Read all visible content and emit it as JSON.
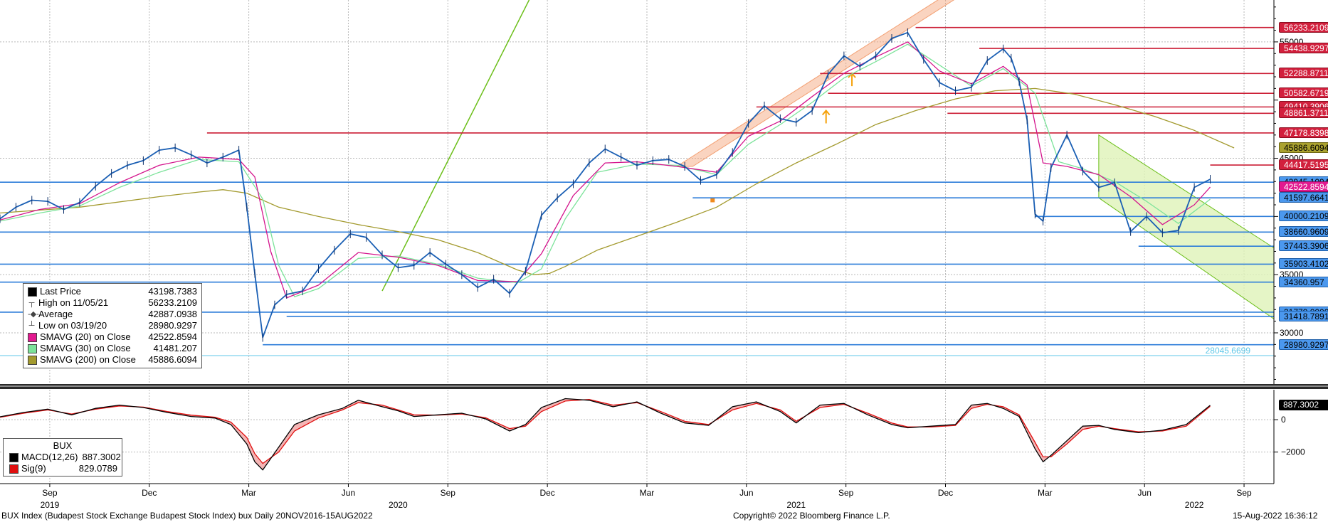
{
  "footer": {
    "left": "BUX Index (Budapest Stock Exchange Budapest Stock Index) bux  Daily 20NOV2016-15AUG2022",
    "center": "Copyright© 2022 Bloomberg Finance L.P.",
    "right": "15-Aug-2022 16:36:12"
  },
  "colors": {
    "price": "#1a5fb4",
    "sma20": "#d4148c",
    "sma30": "#7ce39a",
    "sma200": "#a39a2e",
    "resistance": "#cc1f36",
    "support": "#2e7ed9",
    "trend": "#6cbf1a",
    "channel": "#f3a073",
    "macd": "#000000",
    "signal": "#e01010",
    "hist_fill": "#f2a3a3"
  },
  "upper_legend": {
    "rows": [
      {
        "glyph": "■",
        "label": "Last Price",
        "value": "43198.7383",
        "color": "#000000"
      },
      {
        "glyph": "┬",
        "label": "High on 11/05/21",
        "value": "56233.2109"
      },
      {
        "glyph": "-◆-",
        "label": "Average",
        "value": "42887.0938"
      },
      {
        "glyph": "┴",
        "label": "Low on 03/19/20",
        "value": "28980.9297"
      },
      {
        "glyph": "■",
        "label": "SMAVG (20)  on Close",
        "value": "42522.8594",
        "color": "#e2198f"
      },
      {
        "glyph": "■",
        "label": "SMAVG (30)  on Close",
        "value": "41481.207",
        "color": "#7ce39a"
      },
      {
        "glyph": "■",
        "label": "SMAVG (200)  on Close",
        "value": "45886.6094",
        "color": "#a39a2e"
      }
    ]
  },
  "lower_legend": {
    "title": "BUX",
    "rows": [
      {
        "label": "MACD(12,26)",
        "value": "887.3002",
        "color": "#000000"
      },
      {
        "label": "Sig(9)",
        "value": "829.0789",
        "color": "#e01010"
      }
    ]
  },
  "right_tags": [
    {
      "text": "56233.2109",
      "kind": "resistance",
      "price": 56233.2109
    },
    {
      "text": "54438.9297",
      "kind": "resistance",
      "price": 54438.9297
    },
    {
      "text": "52288.8711",
      "kind": "resistance",
      "price": 52288.8711
    },
    {
      "text": "50582.6719",
      "kind": "resistance",
      "price": 50582.6719
    },
    {
      "text": "49410.3906",
      "kind": "resistance",
      "price": 49410.3906
    },
    {
      "text": "48861.3711",
      "kind": "resistance",
      "price": 48861.3711
    },
    {
      "text": "47178.8398",
      "kind": "resistance",
      "price": 47178.8398
    },
    {
      "text": "45886.6094",
      "kind": "sma200",
      "price": 45886.6094
    },
    {
      "text": "44417.5195",
      "kind": "resistance",
      "price": 44417.5195
    },
    {
      "text": "42945.1094",
      "kind": "support",
      "price": 42945.1094
    },
    {
      "text": "42522.8594",
      "kind": "sma20",
      "price": 42522.8594
    },
    {
      "text": "41597.6641",
      "kind": "support",
      "price": 41597.6641
    },
    {
      "text": "40000.2109",
      "kind": "support",
      "price": 40000.2109
    },
    {
      "text": "38660.9609",
      "kind": "support",
      "price": 38660.9609
    },
    {
      "text": "37443.3906",
      "kind": "support",
      "price": 37443.3906
    },
    {
      "text": "35903.4102",
      "kind": "support",
      "price": 35903.4102
    },
    {
      "text": "34360.957",
      "kind": "support",
      "price": 34360.957
    },
    {
      "text": "31779.0000",
      "kind": "support",
      "price": 31779.0
    },
    {
      "text": "31418.7891",
      "kind": "support",
      "price": 31418.7891
    },
    {
      "text": "28980.9297",
      "kind": "support",
      "price": 28980.9297
    }
  ],
  "low_label": "28045.6699",
  "macd_tag": "887.3002",
  "chart_data": [
    {
      "type": "line",
      "title": "",
      "subtitle": "",
      "xlabel": "",
      "ylabel": "",
      "y_tick_labels": [
        "55000",
        "45000",
        "35000",
        "30000"
      ],
      "y_ticks": [
        55000,
        45000,
        35000,
        30000
      ],
      "ylim": [
        25600,
        58600
      ],
      "x_tick_labels": [
        "Sep",
        "Dec",
        "Mar",
        "Jun",
        "Sep",
        "Dec",
        "Mar",
        "Jun",
        "Sep",
        "Dec",
        "Mar",
        "Jun",
        "Sep"
      ],
      "x_tick_positions": [
        0.125,
        0.375,
        0.625,
        0.875,
        1.125,
        1.375,
        1.625,
        1.875,
        2.125,
        2.375,
        2.625,
        2.875,
        3.125
      ],
      "year_labels": [
        {
          "text": "2019",
          "pos": 0.125
        },
        {
          "text": "2020",
          "pos": 1.0
        },
        {
          "text": "2021",
          "pos": 2.0
        },
        {
          "text": "2022",
          "pos": 3.0
        }
      ],
      "x_domain": [
        0.0,
        3.2
      ],
      "grid": true,
      "legend": "bottom-left",
      "series": [
        {
          "name": "Last Price",
          "x": [
            0.0,
            0.04,
            0.08,
            0.12,
            0.16,
            0.2,
            0.24,
            0.28,
            0.32,
            0.36,
            0.4,
            0.44,
            0.48,
            0.52,
            0.56,
            0.6,
            0.62,
            0.64,
            0.66,
            0.69,
            0.72,
            0.76,
            0.8,
            0.84,
            0.88,
            0.92,
            0.96,
            1.0,
            1.04,
            1.08,
            1.12,
            1.16,
            1.2,
            1.24,
            1.28,
            1.32,
            1.36,
            1.4,
            1.44,
            1.48,
            1.52,
            1.56,
            1.6,
            1.64,
            1.68,
            1.72,
            1.76,
            1.8,
            1.84,
            1.88,
            1.92,
            1.96,
            2.0,
            2.04,
            2.08,
            2.12,
            2.16,
            2.2,
            2.24,
            2.28,
            2.32,
            2.36,
            2.4,
            2.44,
            2.48,
            2.52,
            2.54,
            2.56,
            2.58,
            2.6,
            2.62,
            2.64,
            2.68,
            2.72,
            2.76,
            2.8,
            2.84,
            2.88,
            2.92,
            2.96,
            3.0,
            3.04
          ],
          "y": [
            39800,
            40800,
            41400,
            41300,
            40600,
            41200,
            42600,
            43700,
            44400,
            44800,
            45700,
            45900,
            45300,
            44600,
            45100,
            45700,
            40800,
            35100,
            29600,
            32400,
            33300,
            33600,
            35500,
            37100,
            38500,
            38200,
            36700,
            35600,
            35800,
            36900,
            35900,
            35000,
            33900,
            34600,
            33400,
            35300,
            40100,
            41600,
            42800,
            44600,
            45800,
            45100,
            44400,
            44800,
            44900,
            44300,
            43100,
            43600,
            45500,
            48000,
            49500,
            48400,
            48100,
            49100,
            52200,
            53800,
            52900,
            53800,
            55300,
            55800,
            53500,
            51500,
            50800,
            51100,
            53400,
            54400,
            53600,
            51600,
            48300,
            40200,
            39600,
            44200,
            47000,
            43900,
            42500,
            42900,
            38700,
            40000,
            38600,
            38800,
            42500,
            43200
          ]
        },
        {
          "name": "SMAVG (20) on Close",
          "x": [
            0.0,
            0.1,
            0.2,
            0.3,
            0.4,
            0.5,
            0.6,
            0.64,
            0.68,
            0.72,
            0.8,
            0.9,
            1.0,
            1.1,
            1.2,
            1.3,
            1.36,
            1.44,
            1.52,
            1.6,
            1.7,
            1.8,
            1.88,
            1.96,
            2.04,
            2.12,
            2.2,
            2.28,
            2.36,
            2.44,
            2.52,
            2.58,
            2.62,
            2.68,
            2.76,
            2.84,
            2.92,
            3.0,
            3.04
          ],
          "y": [
            39700,
            40600,
            41100,
            42900,
            44400,
            45100,
            44900,
            43400,
            37000,
            33000,
            34100,
            36900,
            36500,
            35800,
            34500,
            34400,
            36800,
            41800,
            44600,
            44700,
            44300,
            43800,
            46900,
            48200,
            50300,
            52300,
            53700,
            55000,
            52500,
            51400,
            52900,
            51300,
            44600,
            44300,
            43600,
            41700,
            39300,
            41000,
            42522
          ]
        },
        {
          "name": "SMAVG (30) on Close",
          "x": [
            0.0,
            0.1,
            0.2,
            0.3,
            0.4,
            0.5,
            0.6,
            0.66,
            0.7,
            0.74,
            0.8,
            0.9,
            1.0,
            1.1,
            1.2,
            1.3,
            1.36,
            1.42,
            1.5,
            1.6,
            1.7,
            1.8,
            1.88,
            1.96,
            2.04,
            2.12,
            2.2,
            2.28,
            2.36,
            2.44,
            2.52,
            2.6,
            2.66,
            2.72,
            2.8,
            2.88,
            2.96,
            3.04
          ],
          "y": [
            39600,
            40300,
            40900,
            42500,
            43800,
            44900,
            44700,
            41500,
            35800,
            33100,
            33800,
            36400,
            36600,
            35900,
            34700,
            34300,
            35500,
            39800,
            43800,
            44500,
            44400,
            43600,
            46200,
            47900,
            49800,
            51900,
            53300,
            54800,
            53000,
            51200,
            52700,
            50600,
            44700,
            44100,
            43000,
            41300,
            39400,
            41481
          ]
        },
        {
          "name": "SMAVG (200) on Close",
          "x": [
            0.0,
            0.2,
            0.4,
            0.5,
            0.56,
            0.62,
            0.7,
            0.8,
            0.9,
            1.0,
            1.1,
            1.2,
            1.3,
            1.34,
            1.38,
            1.42,
            1.5,
            1.6,
            1.7,
            1.8,
            1.9,
            2.0,
            2.1,
            2.2,
            2.3,
            2.4,
            2.5,
            2.6,
            2.7,
            2.8,
            2.9,
            3.0,
            3.1
          ],
          "y": [
            40300,
            40800,
            41700,
            42100,
            42300,
            42000,
            40800,
            40000,
            39300,
            38700,
            38000,
            36900,
            35400,
            35000,
            35100,
            35700,
            37100,
            38300,
            39500,
            40800,
            42800,
            44600,
            46200,
            47900,
            49100,
            50100,
            50800,
            51000,
            50500,
            49600,
            48600,
            47400,
            45886
          ]
        }
      ],
      "annotations": [
        {
          "kind": "resistance",
          "y": 56233.2109,
          "x_start": 2.3
        },
        {
          "kind": "resistance",
          "y": 54438.9297,
          "x_start": 2.46
        },
        {
          "kind": "resistance",
          "y": 52288.8711,
          "x_start": 2.06
        },
        {
          "kind": "resistance",
          "y": 50582.6719,
          "x_start": 2.08
        },
        {
          "kind": "resistance",
          "y": 49410.3906,
          "x_start": 1.9
        },
        {
          "kind": "resistance",
          "y": 48861.3711,
          "x_start": 2.38
        },
        {
          "kind": "resistance",
          "y": 47178.8398,
          "x_start": 0.52
        },
        {
          "kind": "resistance",
          "y": 44417.5195,
          "x_start": 3.04
        },
        {
          "kind": "support",
          "y": 42945.1094,
          "x_start": 0.0
        },
        {
          "kind": "support",
          "y": 41597.6641,
          "x_start": 1.74
        },
        {
          "kind": "support",
          "y": 40000.2109,
          "x_start": 2.6
        },
        {
          "kind": "support",
          "y": 38660.9609,
          "x_start": 0.0
        },
        {
          "kind": "support",
          "y": 37443.3906,
          "x_start": 2.86
        },
        {
          "kind": "support",
          "y": 35903.4102,
          "x_start": 0.0
        },
        {
          "kind": "support",
          "y": 34360.957,
          "x_start": 0.0
        },
        {
          "kind": "support",
          "y": 31779.0,
          "x_start": 0.0
        },
        {
          "kind": "support",
          "y": 31418.7891,
          "x_start": 0.72
        },
        {
          "kind": "support",
          "y": 28980.9297,
          "x_start": 0.66
        },
        {
          "kind": "support",
          "y": 28045.6699,
          "x_start": 0.0
        }
      ]
    },
    {
      "type": "line",
      "title": "",
      "xlabel": "",
      "ylabel": "",
      "y_tick_labels": [
        "0",
        "−2000"
      ],
      "y_ticks": [
        0,
        -2000
      ],
      "ylim": [
        -3950,
        1850
      ],
      "grid": true,
      "legend": "bottom-left",
      "series": [
        {
          "name": "MACD(12,26)",
          "x": [
            0.0,
            0.06,
            0.12,
            0.18,
            0.24,
            0.3,
            0.36,
            0.42,
            0.48,
            0.54,
            0.58,
            0.62,
            0.64,
            0.66,
            0.7,
            0.74,
            0.8,
            0.86,
            0.9,
            0.96,
            1.0,
            1.04,
            1.1,
            1.16,
            1.22,
            1.28,
            1.32,
            1.36,
            1.42,
            1.48,
            1.54,
            1.6,
            1.66,
            1.72,
            1.78,
            1.84,
            1.9,
            1.96,
            2.0,
            2.06,
            2.12,
            2.18,
            2.24,
            2.28,
            2.34,
            2.4,
            2.44,
            2.48,
            2.52,
            2.56,
            2.6,
            2.62,
            2.64,
            2.68,
            2.72,
            2.76,
            2.8,
            2.86,
            2.92,
            2.98,
            3.04
          ],
          "y": [
            180,
            450,
            650,
            300,
            700,
            900,
            750,
            450,
            200,
            100,
            -300,
            -1500,
            -2600,
            -3100,
            -1700,
            -300,
            300,
            700,
            1200,
            800,
            550,
            200,
            300,
            400,
            50,
            -700,
            -300,
            750,
            1300,
            1200,
            800,
            1100,
            400,
            -200,
            -350,
            800,
            1100,
            500,
            -200,
            900,
            1000,
            300,
            -300,
            -500,
            -400,
            -300,
            900,
            1000,
            700,
            200,
            -1800,
            -2600,
            -2200,
            -1300,
            -400,
            -350,
            -600,
            -800,
            -650,
            -300,
            887
          ]
        },
        {
          "name": "Sig(9)",
          "x": [
            0.0,
            0.06,
            0.12,
            0.18,
            0.24,
            0.3,
            0.36,
            0.42,
            0.48,
            0.54,
            0.58,
            0.62,
            0.64,
            0.66,
            0.7,
            0.74,
            0.8,
            0.86,
            0.9,
            0.96,
            1.0,
            1.04,
            1.1,
            1.16,
            1.22,
            1.28,
            1.32,
            1.36,
            1.42,
            1.48,
            1.54,
            1.6,
            1.66,
            1.72,
            1.78,
            1.84,
            1.9,
            1.96,
            2.0,
            2.06,
            2.12,
            2.18,
            2.24,
            2.28,
            2.34,
            2.4,
            2.44,
            2.48,
            2.52,
            2.56,
            2.6,
            2.62,
            2.64,
            2.68,
            2.72,
            2.76,
            2.8,
            2.86,
            2.92,
            2.98,
            3.04
          ],
          "y": [
            150,
            400,
            600,
            350,
            650,
            850,
            780,
            500,
            280,
            150,
            -150,
            -1100,
            -2100,
            -2700,
            -2000,
            -700,
            100,
            600,
            1050,
            900,
            600,
            300,
            280,
            350,
            120,
            -550,
            -400,
            500,
            1150,
            1250,
            900,
            1050,
            500,
            -100,
            -300,
            600,
            1000,
            600,
            -100,
            750,
            950,
            400,
            -200,
            -450,
            -450,
            -350,
            700,
            950,
            800,
            300,
            -1400,
            -2300,
            -2300,
            -1500,
            -600,
            -400,
            -550,
            -750,
            -700,
            -400,
            829
          ]
        }
      ]
    }
  ]
}
